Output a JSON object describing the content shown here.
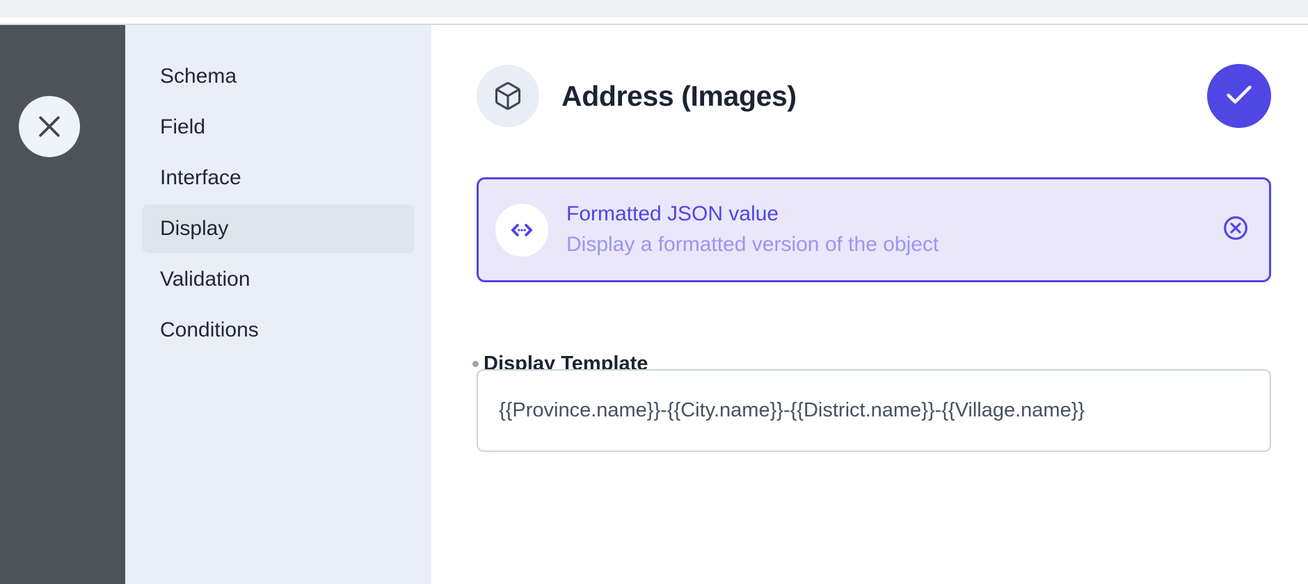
{
  "window": {
    "titlebar_color": "#eef0f2"
  },
  "rail": {
    "background_color": "#4c5459",
    "close_label": "Close",
    "close_icon": "x-icon"
  },
  "nav": {
    "background_color": "#eaeef8",
    "active_item": "Display",
    "items": [
      {
        "label": "Schema",
        "active": false
      },
      {
        "label": "Field",
        "active": false
      },
      {
        "label": "Interface",
        "active": false
      },
      {
        "label": "Display",
        "active": true
      },
      {
        "label": "Validation",
        "active": false
      },
      {
        "label": "Conditions",
        "active": false
      }
    ]
  },
  "header": {
    "icon": "cube-icon",
    "title": "Address (Images)",
    "confirm_icon": "check-icon",
    "confirm_label": "Save",
    "accent_color": "#5046e4"
  },
  "display_option": {
    "icon": "code-brackets-icon",
    "title": "Formatted JSON value",
    "subtitle": "Display a formatted version of the object",
    "remove_icon": "close-circle-icon",
    "selected": true,
    "border_color": "#5046e4",
    "background_color": "#eae7fb",
    "title_color": "#4f46e5",
    "subtitle_color": "#9b95f0"
  },
  "display_template": {
    "label": "Display Template",
    "required": true,
    "value": "{{Province.name}}-{{City.name}}-{{District.name}}-{{Village.name}}",
    "placeholder": "Display Template"
  }
}
